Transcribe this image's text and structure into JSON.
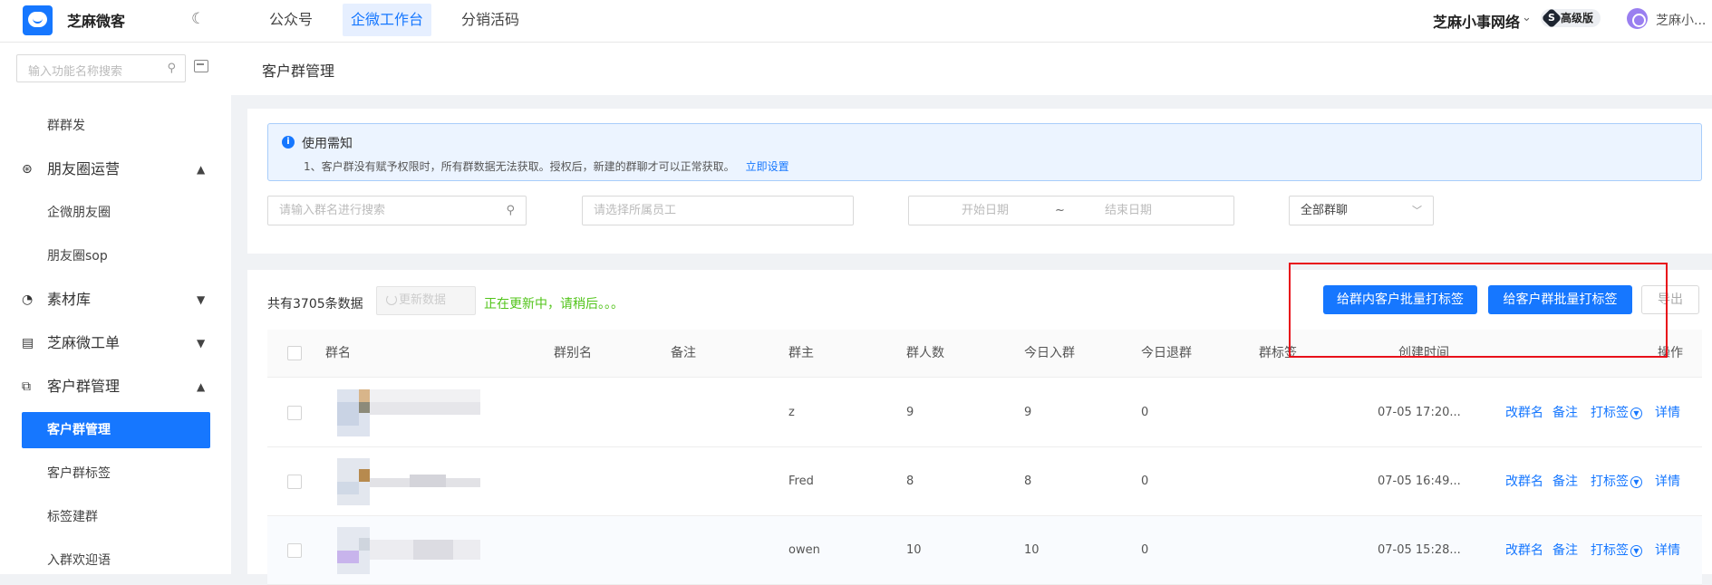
{
  "app": {
    "brand": "芝麻微客",
    "org_name": "芝麻小事网络",
    "plan_badge": "高级版",
    "plan_letter": "S",
    "user_name": "芝麻小..."
  },
  "topnav": [
    {
      "label": "公众号",
      "active": false
    },
    {
      "label": "企微工作台",
      "active": true
    },
    {
      "label": "分销活码",
      "active": false
    }
  ],
  "sidebar": {
    "search_placeholder": "输入功能名称搜索",
    "items": [
      {
        "label": "群群发",
        "type": "sub"
      },
      {
        "label": "朋友圈运营",
        "type": "group",
        "icon": "aperture-icon",
        "chev": "▲"
      },
      {
        "label": "企微朋友圈",
        "type": "sub"
      },
      {
        "label": "朋友圈sop",
        "type": "sub"
      },
      {
        "label": "素材库",
        "type": "group",
        "icon": "library-icon",
        "chev": "▼"
      },
      {
        "label": "芝麻微工单",
        "type": "group",
        "icon": "ticket-icon",
        "chev": "▼"
      },
      {
        "label": "客户群管理",
        "type": "group",
        "icon": "customer-group-icon",
        "chev": "▲"
      },
      {
        "label": "客户群管理",
        "type": "active"
      },
      {
        "label": "客户群标签",
        "type": "sub"
      },
      {
        "label": "标签建群",
        "type": "sub"
      },
      {
        "label": "入群欢迎语",
        "type": "sub"
      }
    ]
  },
  "page": {
    "title": "客户群管理",
    "notice_title": "使用需知",
    "notice_text": "1、客户群没有赋予权限时，所有群数据无法获取。授权后，新建的群聊才可以正常获取。",
    "notice_link": "立即设置",
    "filters": {
      "search_placeholder": "请输入群名进行搜索",
      "staff_placeholder": "请选择所属员工",
      "date_start": "开始日期",
      "date_sep": "~",
      "date_end": "结束日期",
      "group_select": "全部群聊"
    },
    "total": "共有3705条数据",
    "refresh_label": "更新数据",
    "refresh_status": "正在更新中，请稍后。。。",
    "btn_tag_members": "给群内客户批量打标签",
    "btn_tag_groups": "给客户群批量打标签",
    "btn_export": "导出"
  },
  "table": {
    "columns": [
      "群名",
      "群别名",
      "备注",
      "群主",
      "群人数",
      "今日入群",
      "今日退群",
      "群标签",
      "创建时间",
      "操作"
    ],
    "actions": [
      "改群名",
      "备注",
      "打标签",
      "详情"
    ],
    "rows": [
      {
        "owner": "z",
        "members": "9",
        "joined": "9",
        "left": "0",
        "created": "07-05 17:20..."
      },
      {
        "owner": "Fred",
        "members": "8",
        "joined": "8",
        "left": "0",
        "created": "07-05 16:49..."
      },
      {
        "owner": "owen",
        "members": "10",
        "joined": "10",
        "left": "0",
        "created": "07-05 15:28..."
      }
    ]
  },
  "colors": {
    "primary": "#1677ff",
    "success": "#52c41a",
    "highlight": "#e8101a"
  }
}
